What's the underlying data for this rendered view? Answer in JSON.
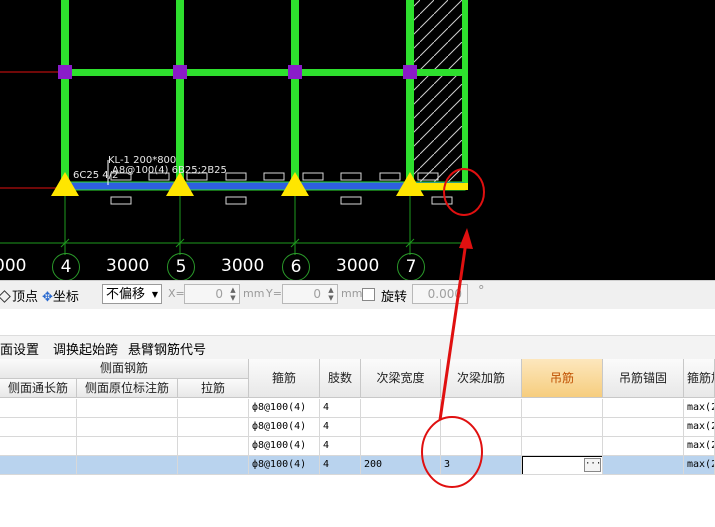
{
  "canvas": {
    "axis_numbers": [
      "4",
      "5",
      "6",
      "7"
    ],
    "spans": [
      "000",
      "3000",
      "3000",
      "3000"
    ],
    "beam_label_line1": "KL-1 200*800",
    "beam_label_line2": "A8@100(4) 6B25;2B25",
    "beam_label_line3": "6C25 4/2",
    "colors": {
      "column_grid": "#2ee02e",
      "column": "#8a1cc9",
      "beam": "#2e5fe0",
      "support": "#ffe600",
      "annotation": "#e01010"
    }
  },
  "toolbar": {
    "vertex_label": "顶点",
    "coordinate_label": "坐标",
    "offset_select": "不偏移",
    "x_label": "X=",
    "x_value": "0",
    "x_unit": "mm",
    "y_label": "Y=",
    "y_value": "0",
    "y_unit": "mm",
    "rotate_label": "旋转",
    "rotate_value": "0.000",
    "rotate_unit": "°"
  },
  "menu": {
    "items": [
      "面设置",
      "调换起始跨",
      "悬臂钢筋代号"
    ]
  },
  "table": {
    "group_header": "侧面钢筋",
    "columns": [
      "侧面通长筋",
      "侧面原位标注筋",
      "拉筋",
      "箍筋",
      "肢数",
      "次梁宽度",
      "次梁加筋",
      "吊筋",
      "吊筋锚固",
      "箍筋加"
    ],
    "highlighted_column": "吊筋",
    "rows": [
      {
        "stirrup": "ф8@100(4)",
        "legs": "4",
        "width": "",
        "add": "",
        "extra": "max(2"
      },
      {
        "stirrup": "ф8@100(4)",
        "legs": "4",
        "width": "",
        "add": "",
        "extra": "max(2"
      },
      {
        "stirrup": "ф8@100(4)",
        "legs": "4",
        "width": "",
        "add": "",
        "extra": "max(2"
      },
      {
        "stirrup": "ф8@100(4)",
        "legs": "4",
        "width": "200",
        "add": "3",
        "extra": "max(2"
      }
    ],
    "edit_button": "···"
  }
}
